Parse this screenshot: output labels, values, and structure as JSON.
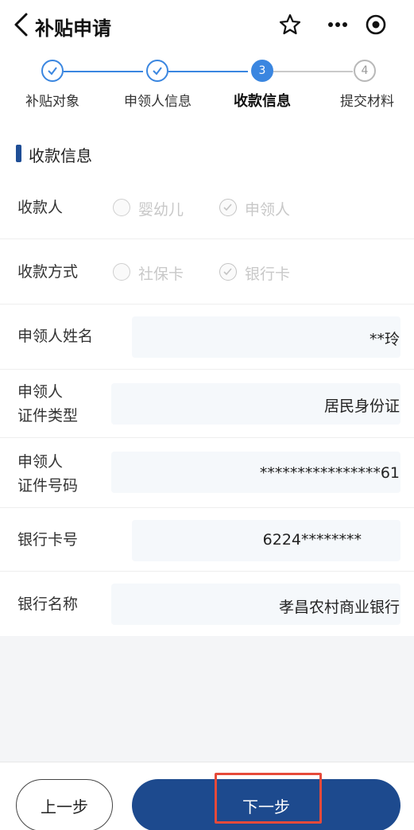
{
  "header": {
    "title": "补贴申请"
  },
  "steps": [
    {
      "label": "补贴对象",
      "state": "done",
      "num": ""
    },
    {
      "label": "申领人信息",
      "state": "done",
      "num": ""
    },
    {
      "label": "收款信息",
      "state": "active",
      "num": "3"
    },
    {
      "label": "提交材料",
      "state": "pending",
      "num": "4"
    }
  ],
  "section": {
    "title": "收款信息"
  },
  "payee": {
    "label": "收款人",
    "options": [
      {
        "label": "婴幼儿",
        "checked": false
      },
      {
        "label": "申领人",
        "checked": true
      }
    ]
  },
  "method": {
    "label": "收款方式",
    "options": [
      {
        "label": "社保卡",
        "checked": false
      },
      {
        "label": "银行卡",
        "checked": true
      }
    ]
  },
  "fields": {
    "name": {
      "label": "申领人姓名",
      "value": "**玲"
    },
    "id_type": {
      "label_line1": "申领人",
      "label_line2": "证件类型",
      "value": "居民身份证"
    },
    "id_number": {
      "label_line1": "申领人",
      "label_line2": "证件号码",
      "value": "****************61"
    },
    "card_no": {
      "label": "银行卡号",
      "value": "6224********"
    },
    "bank_name": {
      "label": "银行名称",
      "value": "孝昌农村商业银行"
    }
  },
  "footer": {
    "prev_label": "上一步",
    "next_label": "下一步"
  },
  "colors": {
    "primary": "#1d4a8e",
    "accent": "#3a86e0",
    "highlight": "#e64a3a"
  }
}
